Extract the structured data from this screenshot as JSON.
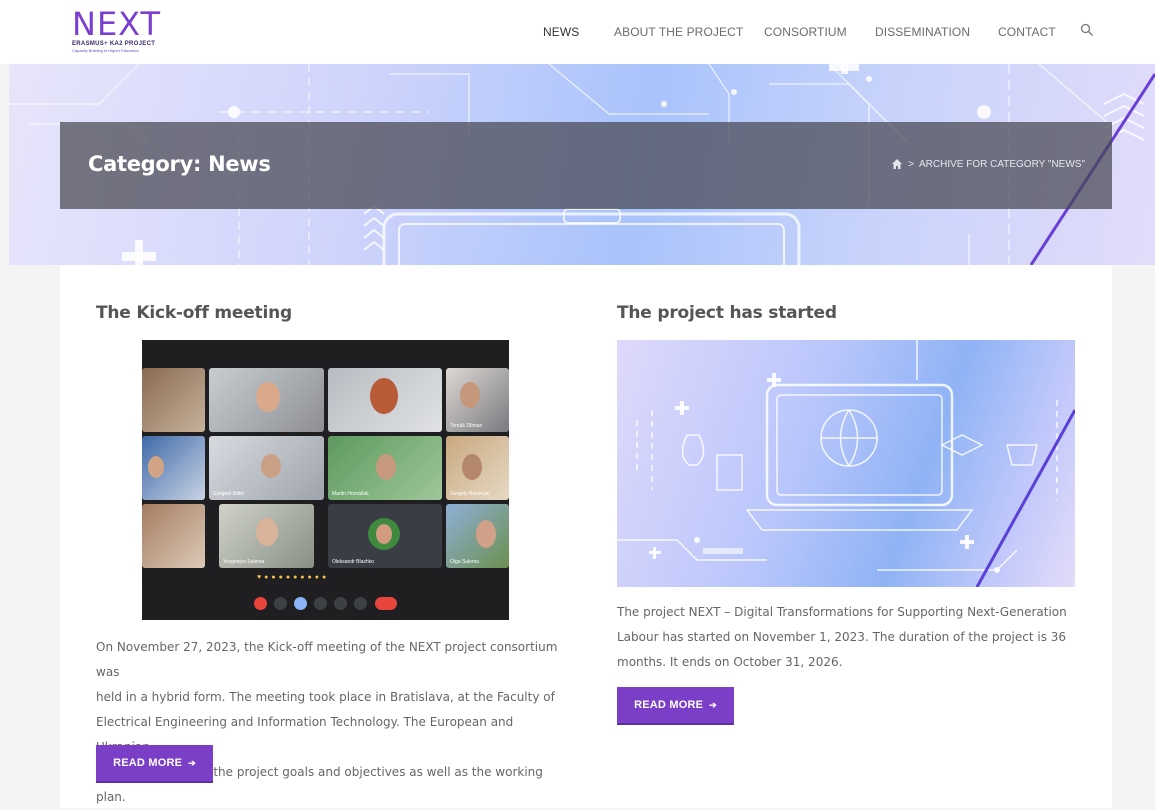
{
  "logo": {
    "mark": "NEXT",
    "line1": "ERASMUS+ KA2 PROJECT",
    "line2": "Capacity Building in Higher Education"
  },
  "nav": {
    "items": [
      {
        "label": "NEWS",
        "active": true
      },
      {
        "label": "ABOUT THE PROJECT"
      },
      {
        "label": "CONSORTIUM"
      },
      {
        "label": "DISSEMINATION"
      },
      {
        "label": "CONTACT"
      }
    ],
    "search_icon": "search-icon"
  },
  "hero": {
    "title": "Category: News",
    "breadcrumb": {
      "home_icon": "home-icon",
      "separator": ">",
      "current": "ARCHIVE FOR CATEGORY \"NEWS\""
    }
  },
  "posts": [
    {
      "title": "The Kick-off meeting",
      "paragraph_lines": [
        "On November 27, 2023, the Kick-off meeting of the NEXT project consortium was",
        "held in a hybrid form. The meeting took place in Bratislava, at the Faculty of",
        "Electrical Engineering and Information Technology. The European and Ukranian",
        "partners discussed the project goals and objectives as well as the working plan."
      ],
      "button": "READ MORE",
      "meeting_names": [
        "Tomáš Zillman",
        "Szegedi Ildikó",
        "Martin Hornáček",
        "Gergely Rozsnyai",
        "Yevgeniya Sulema",
        "Oleksandr Blazhko",
        "Olga Sulema"
      ]
    },
    {
      "title": "The project has started",
      "paragraph_lines": [
        "The project NEXT – Digital Transformations for Supporting Next-Generation",
        "Labour has started on November 1, 2023. The duration of the project is 36",
        "months. It ends on October 31, 2026."
      ],
      "button": "READ MORE"
    }
  ],
  "colors": {
    "accent": "#7a3fc6",
    "title_bar": "#464650"
  }
}
